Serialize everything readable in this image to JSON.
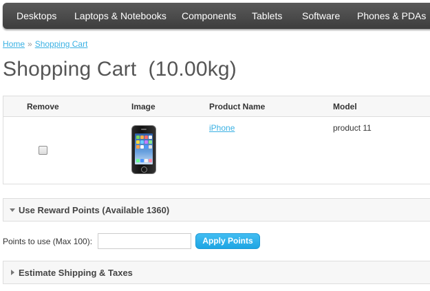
{
  "menu": {
    "items": [
      "Desktops",
      "Laptops & Notebooks",
      "Components",
      "Tablets",
      "Software",
      "Phones & PDAs"
    ]
  },
  "breadcrumb": {
    "home": "Home",
    "separator": "»",
    "current": "Shopping Cart"
  },
  "page": {
    "title": "Shopping Cart  (10.00kg)"
  },
  "cart": {
    "headers": {
      "remove": "Remove",
      "image": "Image",
      "product_name": "Product Name",
      "model": "Model"
    },
    "rows": [
      {
        "product_name": "iPhone",
        "model": "product 11",
        "image_icon": "iphone-product-image"
      }
    ]
  },
  "reward": {
    "section_title": "Use Reward Points (Available 1360)",
    "points_label": "Points to use (Max 100):",
    "input_value": "",
    "apply_button": "Apply Points"
  },
  "shipping": {
    "section_title": "Estimate Shipping & Taxes"
  },
  "colors": {
    "menu_bg": "#4a4a4a",
    "link": "#38b0e3",
    "button": "#2aaee8"
  }
}
